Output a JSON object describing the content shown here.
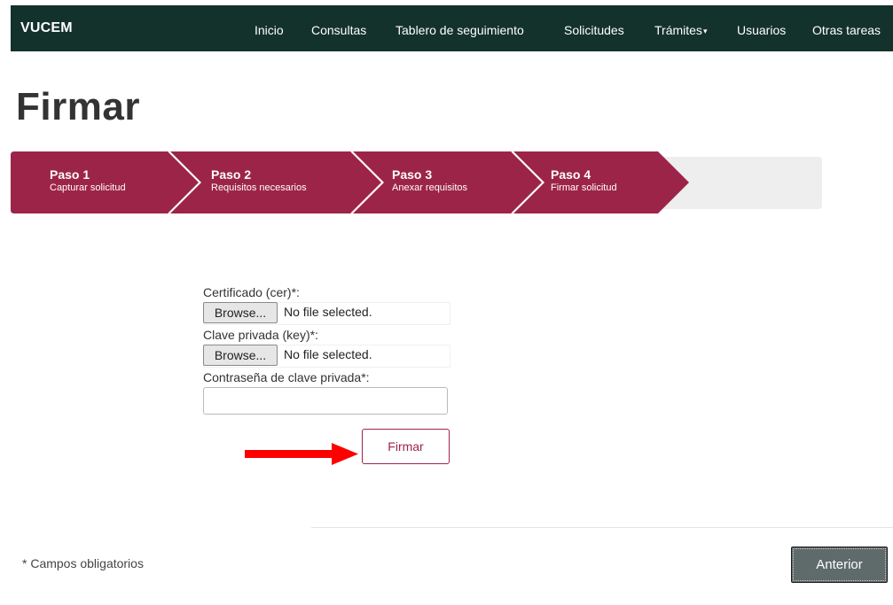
{
  "brand": "VUCEM",
  "nav": {
    "items": [
      {
        "label": "Inicio"
      },
      {
        "label": "Consultas"
      },
      {
        "label": "Tablero de seguimiento"
      },
      {
        "label": "Solicitudes"
      },
      {
        "label": "Trámites",
        "caret": "▾"
      },
      {
        "label": "Usuarios"
      },
      {
        "label": "Otras tareas"
      }
    ]
  },
  "page": {
    "title": "Firmar"
  },
  "wizard": {
    "steps": [
      {
        "title": "Paso 1",
        "subtitle": "Capturar solicitud"
      },
      {
        "title": "Paso 2",
        "subtitle": "Requisitos necesarios"
      },
      {
        "title": "Paso 3",
        "subtitle": "Anexar requisitos"
      },
      {
        "title": "Paso 4",
        "subtitle": "Firmar solicitud"
      }
    ]
  },
  "form": {
    "cert_label": "Certificado (cer)*:",
    "key_label": "Clave privada (key)*:",
    "password_label": "Contraseña de clave privada*:",
    "password_value": "",
    "browse_label": "Browse...",
    "no_file_text": "No file selected.",
    "submit_label": "Firmar"
  },
  "footer": {
    "required_note": "* Campos obligatorios",
    "previous_label": "Anterior"
  },
  "colors": {
    "nav_bg": "#13322b",
    "step_bg": "#9d2449",
    "accent": "#9d2449",
    "arrow": "#ff0000",
    "previous_button_bg": "#5f6b6a"
  },
  "icons": {
    "annotation": "right-arrow-icon"
  }
}
